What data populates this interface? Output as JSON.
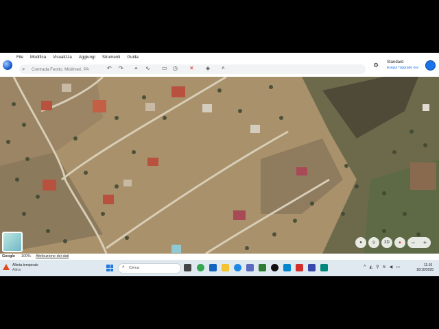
{
  "menu": [
    "File",
    "Modifica",
    "Visualizza",
    "Aggiungi",
    "Strumenti",
    "Guida"
  ],
  "search": {
    "value": "Contrada Feotto, Misilmeri, PA"
  },
  "toolbar_icons": [
    "undo-icon",
    "redo-icon",
    "pin-icon",
    "path-icon",
    "ruler-icon",
    "history-icon",
    "tools-icon",
    "layers-icon",
    "chevron-up-icon"
  ],
  "account": {
    "title": "Standard",
    "subtitle": "Esegui l'upgrade ora"
  },
  "map_controls": {
    "mode_3d": "3D",
    "zoom_out": "−",
    "zoom_in": "+"
  },
  "status": {
    "brand": "Google",
    "zoom": "100%",
    "attribution": "Attribuzione dei dati"
  },
  "taskbar": {
    "weather_title": "Allerta temporale",
    "weather_sub": "Attivo",
    "search_placeholder": "Cerca",
    "time": "11:16",
    "date": "16/10/2025"
  },
  "colors": {
    "accent": "#1a73e8",
    "taskbar": "#dfe9ef"
  }
}
